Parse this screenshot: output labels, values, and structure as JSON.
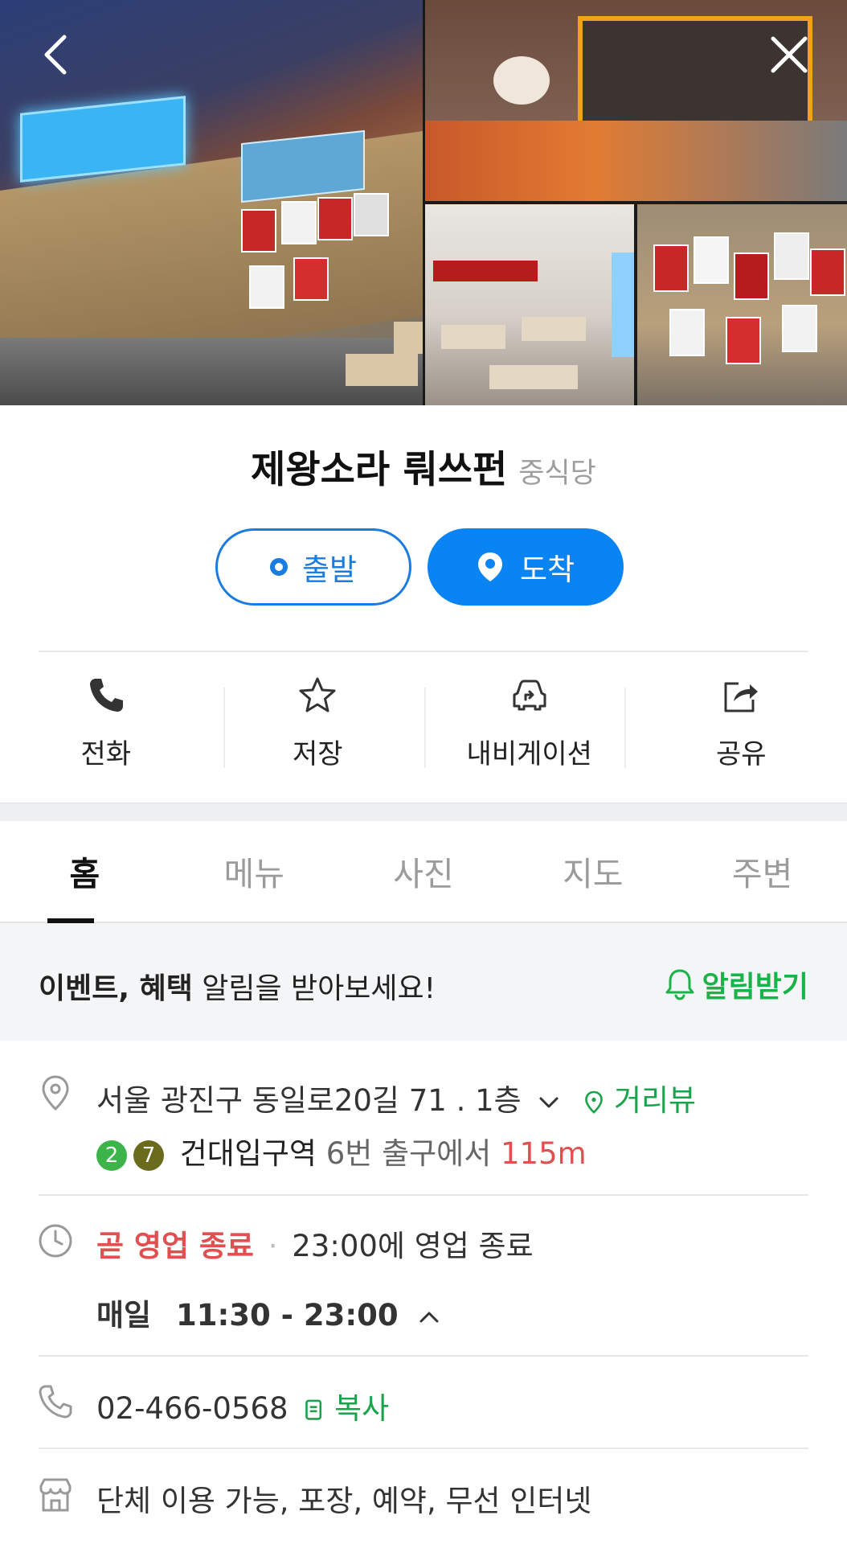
{
  "header": {
    "back_icon": "chevron-left-icon",
    "close_icon": "close-icon"
  },
  "place": {
    "name": "제왕소라 뤄쓰펀",
    "category": "중식당"
  },
  "route": {
    "start_label": "출발",
    "end_label": "도착"
  },
  "actions": [
    {
      "label": "전화",
      "icon": "phone-icon"
    },
    {
      "label": "저장",
      "icon": "star-icon"
    },
    {
      "label": "내비게이션",
      "icon": "car-navigation-icon"
    },
    {
      "label": "공유",
      "icon": "share-icon"
    }
  ],
  "tabs": [
    {
      "label": "홈",
      "active": true
    },
    {
      "label": "메뉴",
      "active": false
    },
    {
      "label": "사진",
      "active": false
    },
    {
      "label": "지도",
      "active": false
    },
    {
      "label": "주변",
      "active": false
    }
  ],
  "alarm_banner": {
    "bold_text": "이벤트, 혜택",
    "text": " 알림을 받아보세요!",
    "button_label": "알림받기"
  },
  "address": {
    "text": "서울 광진구 동일로20길 71 . 1층",
    "street_view_label": "거리뷰",
    "lines": [
      {
        "number": "2",
        "color": "#3cb44a"
      },
      {
        "number": "7",
        "color": "#6b6b1e"
      }
    ],
    "station": "건대입구역",
    "exit_text": "6번 출구에서",
    "distance": "115m"
  },
  "hours": {
    "status": "곧 영업 종료",
    "dot": "·",
    "closing_text": "23:00에 영업 종료",
    "days": "매일",
    "time": "11:30 - 23:00"
  },
  "phone": {
    "number": "02-466-0568",
    "copy_label": "복사"
  },
  "amenities": {
    "text": "단체 이용 가능, 포장, 예약, 무선 인터넷"
  },
  "colors": {
    "primary_blue": "#0a84f2",
    "green": "#19a34a",
    "red": "#e05050"
  }
}
